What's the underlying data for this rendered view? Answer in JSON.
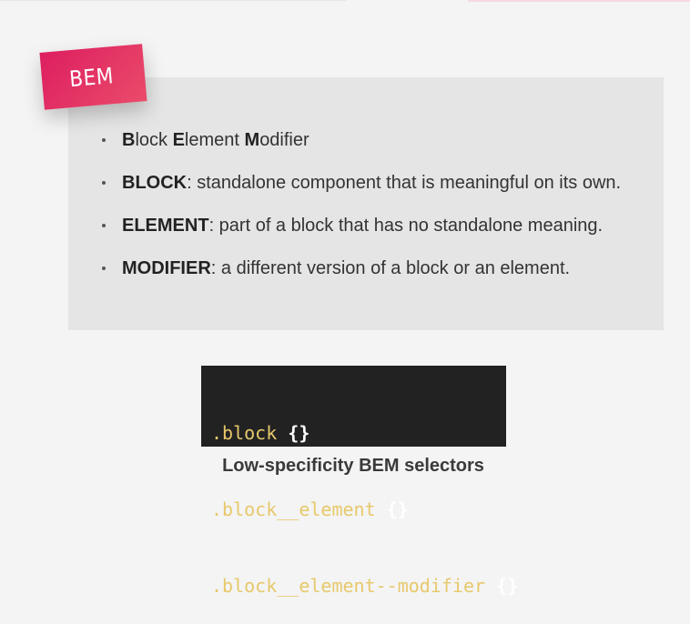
{
  "badge": {
    "label": "BEM",
    "color_start": "#dd1e60",
    "color_end": "#ea4b6a"
  },
  "bullets": [
    {
      "parts": [
        {
          "text": "B",
          "bold": true
        },
        {
          "text": "lock ",
          "bold": false
        },
        {
          "text": "E",
          "bold": true
        },
        {
          "text": "lement ",
          "bold": false
        },
        {
          "text": "M",
          "bold": true
        },
        {
          "text": "odifier",
          "bold": false
        }
      ]
    },
    {
      "parts": [
        {
          "text": "BLOCK",
          "bold": true
        },
        {
          "text": ": standalone component that is meaningful on its own.",
          "bold": false
        }
      ]
    },
    {
      "parts": [
        {
          "text": "ELEMENT",
          "bold": true
        },
        {
          "text": ": part of a block that has no standalone meaning.",
          "bold": false
        }
      ]
    },
    {
      "parts": [
        {
          "text": "MODIFIER",
          "bold": true
        },
        {
          "text": ": a different version of a block or an element.",
          "bold": false
        }
      ]
    }
  ],
  "code": {
    "lines": [
      {
        "selector": ".block",
        "braces": "{}"
      },
      {
        "selector": ".block__element",
        "braces": "{}"
      },
      {
        "selector": ".block__element--modifier",
        "braces": "{}"
      }
    ],
    "background": "#222222",
    "selector_color": "#e7c86b"
  },
  "caption": "Low-specificity BEM selectors"
}
